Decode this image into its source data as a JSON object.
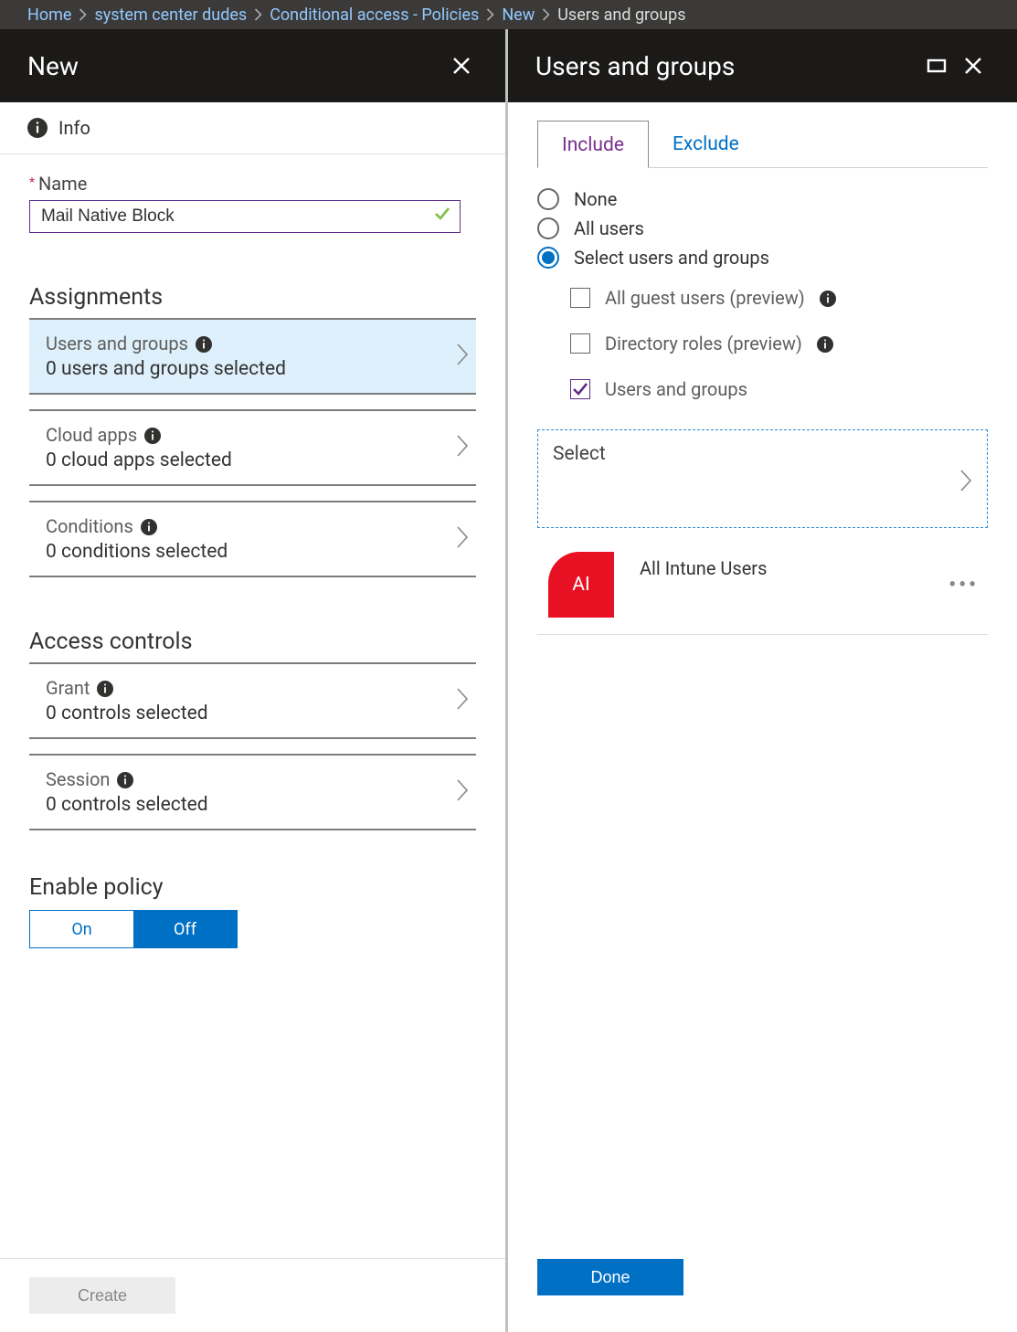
{
  "breadcrumb": [
    {
      "label": "Home",
      "link": true
    },
    {
      "label": "system center dudes",
      "link": true
    },
    {
      "label": "Conditional access - Policies",
      "link": true
    },
    {
      "label": "New",
      "link": true
    },
    {
      "label": "Users and groups",
      "link": false
    }
  ],
  "leftBlade": {
    "title": "New",
    "infoLabel": "Info",
    "nameField": {
      "label": "Name",
      "value": "Mail Native Block"
    },
    "assignmentsHeading": "Assignments",
    "assignments": [
      {
        "title": "Users and groups",
        "sub": "0 users and groups selected",
        "selected": true
      },
      {
        "title": "Cloud apps",
        "sub": "0 cloud apps selected",
        "selected": false
      },
      {
        "title": "Conditions",
        "sub": "0 conditions selected",
        "selected": false
      }
    ],
    "accessHeading": "Access controls",
    "accessControls": [
      {
        "title": "Grant",
        "sub": "0 controls selected"
      },
      {
        "title": "Session",
        "sub": "0 controls selected"
      }
    ],
    "enablePolicy": {
      "heading": "Enable policy",
      "on": "On",
      "off": "Off",
      "value": "Off"
    },
    "createButton": "Create"
  },
  "rightBlade": {
    "title": "Users and groups",
    "tabs": {
      "include": "Include",
      "exclude": "Exclude",
      "active": "include"
    },
    "radios": {
      "none": "None",
      "all": "All users",
      "select": "Select users and groups",
      "value": "select"
    },
    "checks": {
      "guest": {
        "label": "All guest users (preview)",
        "checked": false
      },
      "roles": {
        "label": "Directory roles (preview)",
        "checked": false
      },
      "groups": {
        "label": "Users and groups",
        "checked": true
      }
    },
    "selectBox": "Select",
    "groups": [
      {
        "initials": "AI",
        "name": "All Intune Users"
      }
    ],
    "doneButton": "Done"
  }
}
